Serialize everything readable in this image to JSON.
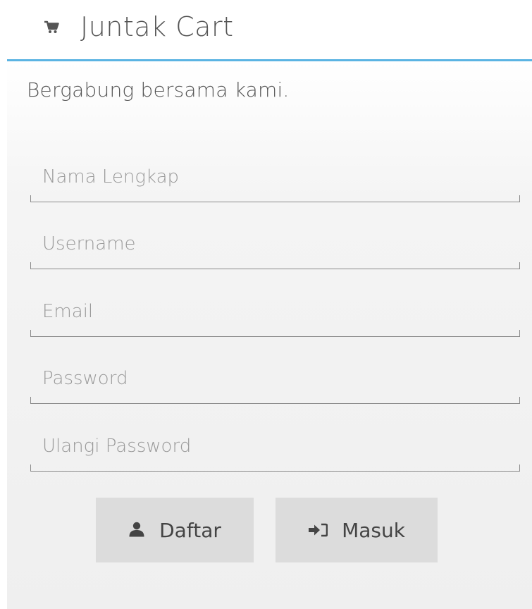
{
  "header": {
    "title": "Juntak Cart",
    "icon": "shopping-cart-icon"
  },
  "panel": {
    "tagline": "Bergabung bersama kami.",
    "accent_color": "#5bb4e3"
  },
  "form": {
    "fields": [
      {
        "placeholder": "Nama Lengkap",
        "value": ""
      },
      {
        "placeholder": "Username",
        "value": ""
      },
      {
        "placeholder": "Email",
        "value": ""
      },
      {
        "placeholder": "Password",
        "value": ""
      },
      {
        "placeholder": "Ulangi Password",
        "value": ""
      }
    ],
    "daftar_label": "Daftar",
    "daftar_icon": "user-icon",
    "masuk_label": "Masuk",
    "masuk_icon": "sign-in-icon"
  }
}
